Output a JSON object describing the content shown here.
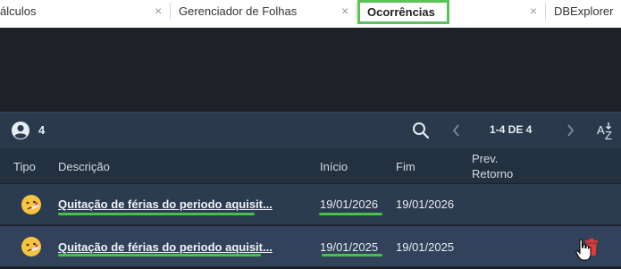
{
  "tabs": {
    "items": [
      {
        "label": "álculos"
      },
      {
        "label": "Gerenciador de Folhas"
      },
      {
        "label": "Ocorrências",
        "active": true
      },
      {
        "label": "DBExplorer"
      }
    ],
    "close_glyph": "×"
  },
  "toolbar": {
    "count": "4",
    "pagination": "1-4 DE 4",
    "user_icon": "account-circle-icon",
    "search_icon": "search-icon",
    "prev_icon": "chevron-left-icon",
    "next_icon": "chevron-right-icon",
    "sort_icon": "sort-az-icon"
  },
  "table": {
    "headers": {
      "tipo": "Tipo",
      "descricao": "Descrição",
      "inicio": "Início",
      "fim": "Fim",
      "prev_retorno_line1": "Prev.",
      "prev_retorno_line2": "Retorno"
    },
    "rows": [
      {
        "icon": "sick-face-icon",
        "descricao": "Quitação de férias do periodo aquisit...",
        "inicio": "19/01/2026",
        "fim": "19/01/2026",
        "prev_retorno": ""
      },
      {
        "icon": "sick-face-icon",
        "descricao": "Quitação de férias do periodo aquisit...",
        "inicio": "19/01/2025",
        "fim": "19/01/2025",
        "prev_retorno": ""
      }
    ]
  },
  "colors": {
    "accent_highlight": "#44c24a",
    "toolbar_bg": "#2a3a4c",
    "row_bg": "#2b3c50",
    "delete_red": "#e53935"
  }
}
